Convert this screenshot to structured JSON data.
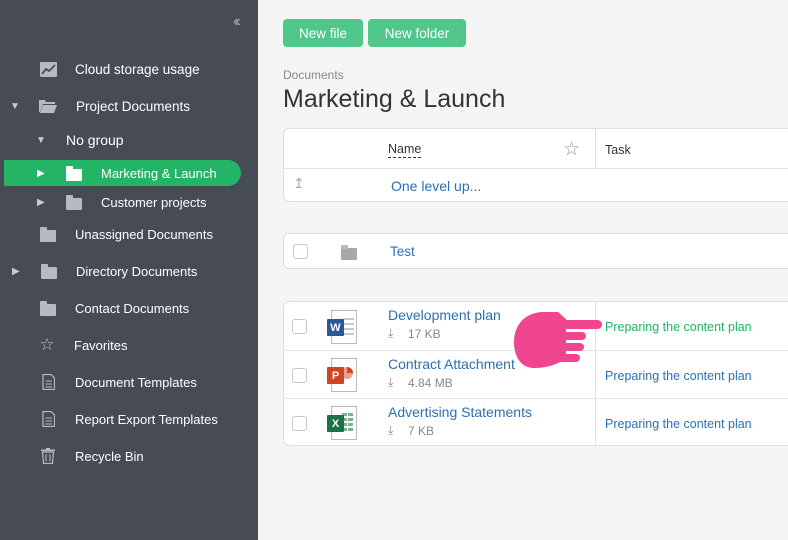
{
  "sidebar": {
    "collapse_icon": "double-chevron-left-icon",
    "items": [
      {
        "label": "Cloud storage usage",
        "icon": "chart-icon"
      },
      {
        "label": "Project Documents",
        "icon": "open-folder-icon"
      },
      {
        "label": "No group"
      },
      {
        "label": "Marketing & Launch",
        "icon": "folder-icon"
      },
      {
        "label": "Customer projects",
        "icon": "folder-icon"
      },
      {
        "label": "Unassigned Documents",
        "icon": "folder-icon"
      },
      {
        "label": "Directory Documents",
        "icon": "folder-icon"
      },
      {
        "label": "Contact Documents",
        "icon": "folder-icon"
      },
      {
        "label": "Favorites",
        "icon": "star-icon"
      },
      {
        "label": "Document Templates",
        "icon": "document-icon"
      },
      {
        "label": "Report Export Templates",
        "icon": "document-icon"
      },
      {
        "label": "Recycle Bin",
        "icon": "trash-icon"
      }
    ]
  },
  "toolbar": {
    "new_file": "New file",
    "new_folder": "New folder"
  },
  "breadcrumb": "Documents",
  "page_title": "Marketing & Launch",
  "table": {
    "columns": {
      "name": "Name",
      "task": "Task"
    },
    "up_label": "One level up...",
    "folders": [
      {
        "name": "Test"
      }
    ],
    "files": [
      {
        "name": "Development plan",
        "size": "17 KB",
        "type": "W",
        "task": "Preparing the content plan",
        "task_color": "#23b466"
      },
      {
        "name": "Contract Attachment",
        "size": "4.84 MB",
        "type": "P",
        "task": "Preparing the content plan",
        "task_color": "#2c6fb3"
      },
      {
        "name": "Advertising Statements",
        "size": "7 KB",
        "type": "X",
        "task": "Preparing the content plan",
        "task_color": "#2c6fb3"
      }
    ]
  },
  "colors": {
    "accent": "#23b466",
    "button": "#4fc68a",
    "sidebar": "#464b56",
    "link": "#2c6fb3",
    "pointer": "#f0458f",
    "word": "#2b5797",
    "powerpoint": "#d04423",
    "excel": "#1e7145"
  }
}
